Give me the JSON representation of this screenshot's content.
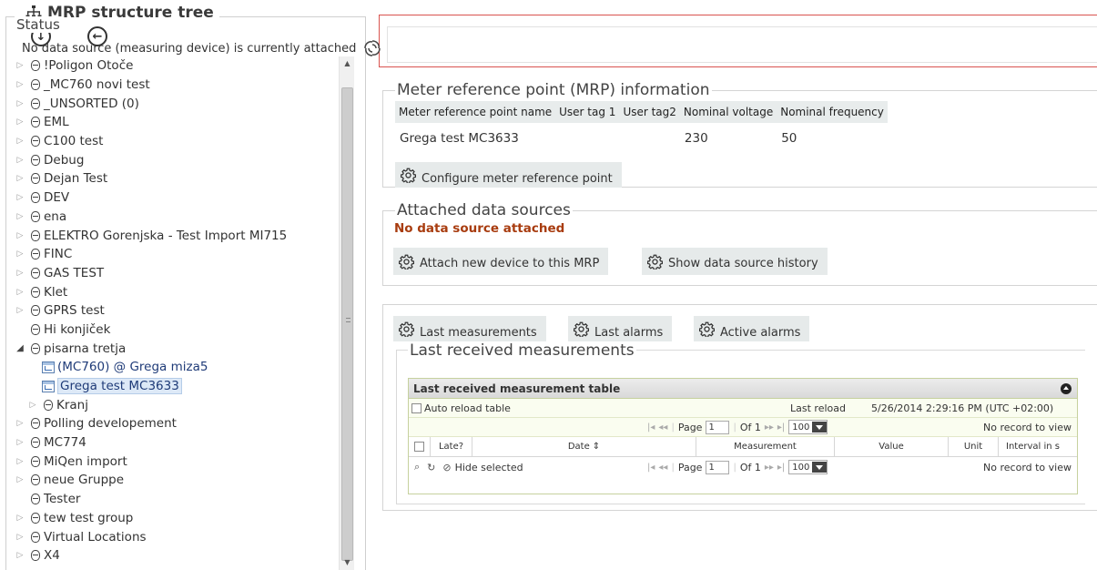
{
  "tree_panel": {
    "title": "MRP structure tree",
    "items": [
      {
        "label": "!Poligon Otoče",
        "expander": "closed",
        "icon": "group",
        "indent": 0
      },
      {
        "label": "_MC760 novi test",
        "expander": "closed",
        "icon": "group",
        "indent": 0
      },
      {
        "label": "_UNSORTED (0)",
        "expander": "closed",
        "icon": "group",
        "indent": 0
      },
      {
        "label": "EML",
        "expander": "closed",
        "icon": "group",
        "indent": 0
      },
      {
        "label": "C100 test",
        "expander": "closed",
        "icon": "group",
        "indent": 0
      },
      {
        "label": "Debug",
        "expander": "closed",
        "icon": "group",
        "indent": 0
      },
      {
        "label": "Dejan Test",
        "expander": "closed",
        "icon": "group",
        "indent": 0
      },
      {
        "label": "DEV",
        "expander": "closed",
        "icon": "group",
        "indent": 0
      },
      {
        "label": "ena",
        "expander": "closed",
        "icon": "group",
        "indent": 0
      },
      {
        "label": "ELEKTRO Gorenjska - Test Import MI715",
        "expander": "closed",
        "icon": "group",
        "indent": 0
      },
      {
        "label": "FINC",
        "expander": "closed",
        "icon": "group",
        "indent": 0
      },
      {
        "label": "GAS TEST",
        "expander": "closed",
        "icon": "group",
        "indent": 0
      },
      {
        "label": "Klet",
        "expander": "closed",
        "icon": "group",
        "indent": 0
      },
      {
        "label": "GPRS test",
        "expander": "closed",
        "icon": "group",
        "indent": 0
      },
      {
        "label": "Hi konjiček",
        "expander": "none",
        "icon": "group",
        "indent": 0
      },
      {
        "label": "pisarna tretja",
        "expander": "open",
        "icon": "group",
        "indent": 0
      },
      {
        "label": "(MC760) @ Grega miza5",
        "expander": "none",
        "icon": "device",
        "indent": 1
      },
      {
        "label": "Grega test MC3633",
        "expander": "none",
        "icon": "device",
        "indent": 1,
        "selected": true
      },
      {
        "label": "Kranj",
        "expander": "closed",
        "icon": "group",
        "indent": 1
      },
      {
        "label": "Polling developement",
        "expander": "closed",
        "icon": "group",
        "indent": 0
      },
      {
        "label": "MC774",
        "expander": "closed",
        "icon": "group",
        "indent": 0
      },
      {
        "label": "MiQen import",
        "expander": "closed",
        "icon": "group",
        "indent": 0
      },
      {
        "label": "neue Gruppe",
        "expander": "closed",
        "icon": "group",
        "indent": 0
      },
      {
        "label": "Tester",
        "expander": "none",
        "icon": "group",
        "indent": 0
      },
      {
        "label": "tew test group",
        "expander": "closed",
        "icon": "group",
        "indent": 0
      },
      {
        "label": "Virtual Locations",
        "expander": "closed",
        "icon": "group",
        "indent": 0
      },
      {
        "label": "X4",
        "expander": "closed",
        "icon": "group",
        "indent": 0
      }
    ]
  },
  "status": {
    "legend": "Status",
    "text": "No data source (measuring device) is currently attached",
    "border_color": "#d9534f"
  },
  "mrp_info": {
    "legend": "Meter reference point (MRP) information",
    "columns": [
      "Meter reference point name",
      "User tag 1",
      "User tag2",
      "Nominal voltage",
      "Nominal frequency"
    ],
    "row": [
      "Grega test MC3633",
      "",
      "",
      "230",
      "50"
    ],
    "configure_button": "Configure meter reference point"
  },
  "attached": {
    "legend": "Attached data sources",
    "no_source": "No data source attached",
    "attach_button": "Attach new device to this MRP",
    "history_button": "Show data source history",
    "warning_color": "#a83c0f"
  },
  "measurements": {
    "tabs": [
      "Last measurements",
      "Last alarms",
      "Active alarms"
    ],
    "legend": "Last received measurements",
    "grid": {
      "title": "Last received measurement table",
      "auto_reload": "Auto reload table",
      "last_reload_label": "Last reload",
      "last_reload_value": "5/26/2014 2:29:16 PM (UTC +02:00)",
      "page_label": "Page",
      "page_value": "1",
      "of_label": "Of 1",
      "page_size": "100",
      "no_records": "No record to view",
      "columns": [
        "Late?",
        "Date",
        "Measurement",
        "Value",
        "Unit",
        "Interval in s"
      ],
      "hide_selected": "Hide selected"
    }
  }
}
